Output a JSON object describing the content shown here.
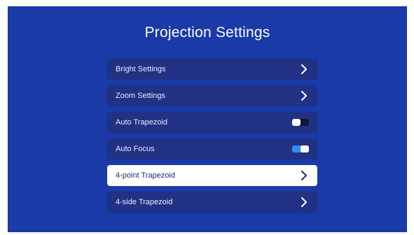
{
  "screen": {
    "title": "Projection Settings",
    "background": "#1a3aa8"
  },
  "menu": {
    "items": [
      {
        "label": "Bright Settings",
        "control": "chevron-right-icon",
        "selected": false
      },
      {
        "label": "Zoom Settings",
        "control": "chevron-right-icon",
        "selected": false
      },
      {
        "label": "Auto Trapezoid",
        "control": "toggle",
        "state": "off",
        "selected": false
      },
      {
        "label": "Auto Focus",
        "control": "toggle",
        "state": "on",
        "selected": false
      },
      {
        "label": "4-point Trapezoid",
        "control": "chevron-right-icon",
        "selected": true
      },
      {
        "label": "4-side Trapezoid",
        "control": "chevron-right-icon",
        "selected": false
      }
    ]
  },
  "colors": {
    "item_bg": "#213184",
    "selected_bg": "#ffffff",
    "toggle_on": "#2f8df0",
    "toggle_off": "#111633"
  }
}
